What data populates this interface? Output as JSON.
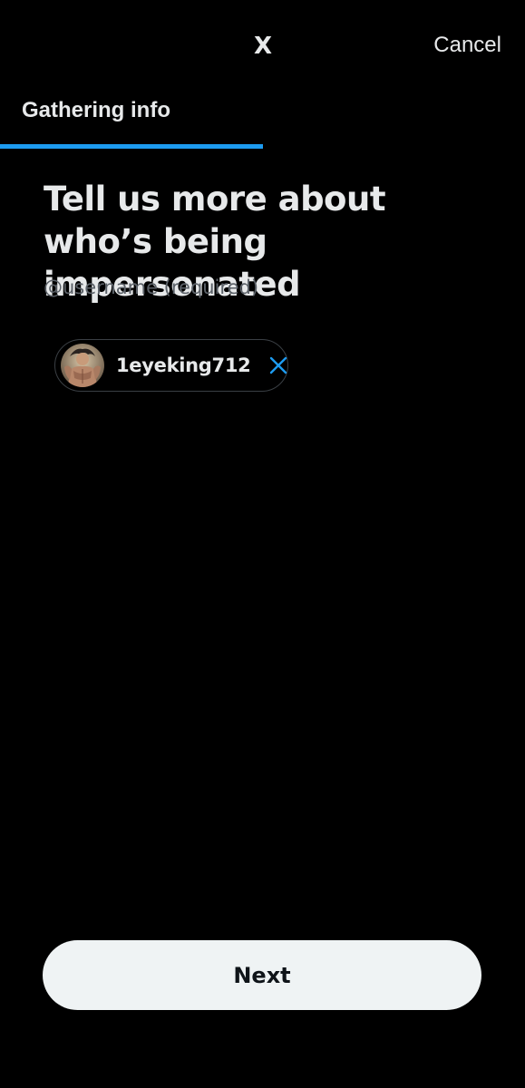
{
  "header": {
    "logo_label": "X",
    "cancel_label": "Cancel"
  },
  "step": {
    "label": "Gathering info",
    "progress": 0.5
  },
  "form": {
    "heading": "Tell us more about who’s being impersonated",
    "field_hint": "@username (required)",
    "selected_user": {
      "username": "1eyeking712",
      "avatar_icon": "user-avatar-icon",
      "remove_icon": "close-icon"
    }
  },
  "footer": {
    "next_label": "Next"
  },
  "colors": {
    "background": "#000000",
    "text": "#e7e9ea",
    "muted": "#5b6168",
    "accent": "#1d9bf0",
    "button_bg": "#eff3f4",
    "button_text": "#0f1419"
  }
}
